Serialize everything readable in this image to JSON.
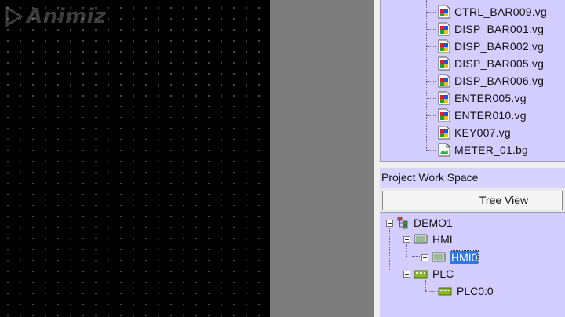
{
  "watermark": {
    "brand": "Animiz"
  },
  "file_list": {
    "items": [
      {
        "label": "CTRL_BAR009.vg",
        "icon": "vg-file-icon"
      },
      {
        "label": "DISP_BAR001.vg",
        "icon": "vg-file-icon"
      },
      {
        "label": "DISP_BAR002.vg",
        "icon": "vg-file-icon"
      },
      {
        "label": "DISP_BAR005.vg",
        "icon": "vg-file-icon"
      },
      {
        "label": "DISP_BAR006.vg",
        "icon": "vg-file-icon"
      },
      {
        "label": "ENTER005.vg",
        "icon": "vg-file-icon"
      },
      {
        "label": "ENTER010.vg",
        "icon": "vg-file-icon"
      },
      {
        "label": "KEY007.vg",
        "icon": "vg-file-icon"
      },
      {
        "label": "METER_01.bg",
        "icon": "bg-file-icon"
      }
    ]
  },
  "workspace": {
    "title": "Project Work Space",
    "tree_view_label": "Tree View",
    "tree": {
      "root": "DEMO1",
      "hmi": "HMI",
      "hmi_child": "HMI0",
      "plc": "PLC",
      "plc_child": "PLC0:0"
    }
  },
  "colors": {
    "panel_bg": "#d3ceff",
    "selection": "#2f77e0",
    "canvas_bg": "#000000",
    "gray_area": "#7d7d7d"
  }
}
